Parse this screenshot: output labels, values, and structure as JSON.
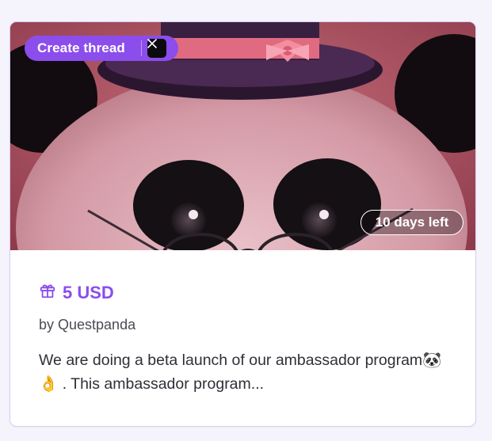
{
  "card": {
    "create_thread_label": "Create thread",
    "social_icon": "x-logo-icon",
    "days_left": "10 days left",
    "reward_icon": "gift-icon",
    "reward_amount": "5 USD",
    "author": "by Questpanda",
    "description": "We are doing a beta launch of our ambassador program🐼 👌 . This ambassador program..."
  },
  "colors": {
    "accent": "#8b4dec",
    "card_border": "#d8cef0",
    "hero_background": "#b55968"
  }
}
